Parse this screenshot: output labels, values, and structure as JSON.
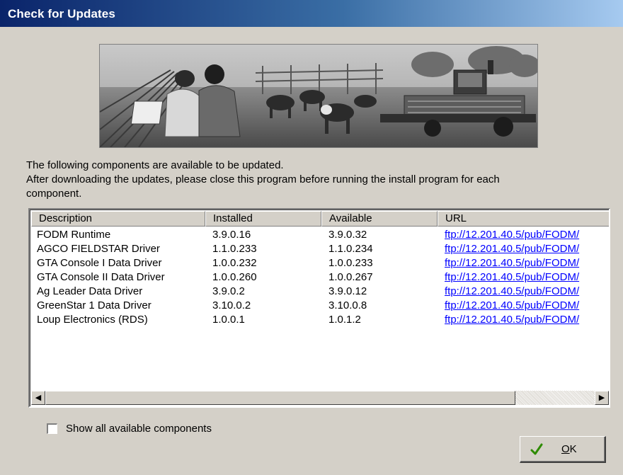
{
  "window": {
    "title": "Check for Updates"
  },
  "banner": {
    "image": "farm-scene-banner"
  },
  "intro": {
    "line1": "The following components are available to be updated.",
    "line2": "After downloading the updates, please close this program before running the install program for each",
    "line3": "component."
  },
  "table": {
    "columns": [
      "Description",
      "Installed",
      "Available",
      "URL"
    ],
    "rows": [
      {
        "description": "FODM Runtime",
        "installed": "3.9.0.16",
        "available": "3.9.0.32",
        "url": "ftp://12.201.40.5/pub/FODM/"
      },
      {
        "description": "AGCO FIELDSTAR Driver",
        "installed": "1.1.0.233",
        "available": "1.1.0.234",
        "url": "ftp://12.201.40.5/pub/FODM/"
      },
      {
        "description": "GTA Console I Data Driver",
        "installed": "1.0.0.232",
        "available": "1.0.0.233",
        "url": "ftp://12.201.40.5/pub/FODM/"
      },
      {
        "description": "GTA Console II Data Driver",
        "installed": "1.0.0.260",
        "available": "1.0.0.267",
        "url": "ftp://12.201.40.5/pub/FODM/"
      },
      {
        "description": "Ag Leader Data Driver",
        "installed": "3.9.0.2",
        "available": "3.9.0.12",
        "url": "ftp://12.201.40.5/pub/FODM/"
      },
      {
        "description": "GreenStar 1 Data Driver",
        "installed": "3.10.0.2",
        "available": "3.10.0.8",
        "url": "ftp://12.201.40.5/pub/FODM/"
      },
      {
        "description": "Loup Electronics (RDS)",
        "installed": "1.0.0.1",
        "available": "1.0.1.2",
        "url": "ftp://12.201.40.5/pub/FODM/"
      }
    ],
    "scrollbar": {
      "left_arrow": "◀",
      "right_arrow": "▶"
    }
  },
  "show_all": {
    "label": "Show all available components",
    "checked": false
  },
  "ok_button": {
    "label_underlined": "O",
    "label_rest": "K",
    "icon": "green-check-icon",
    "icon_color": "#2e8b00"
  }
}
